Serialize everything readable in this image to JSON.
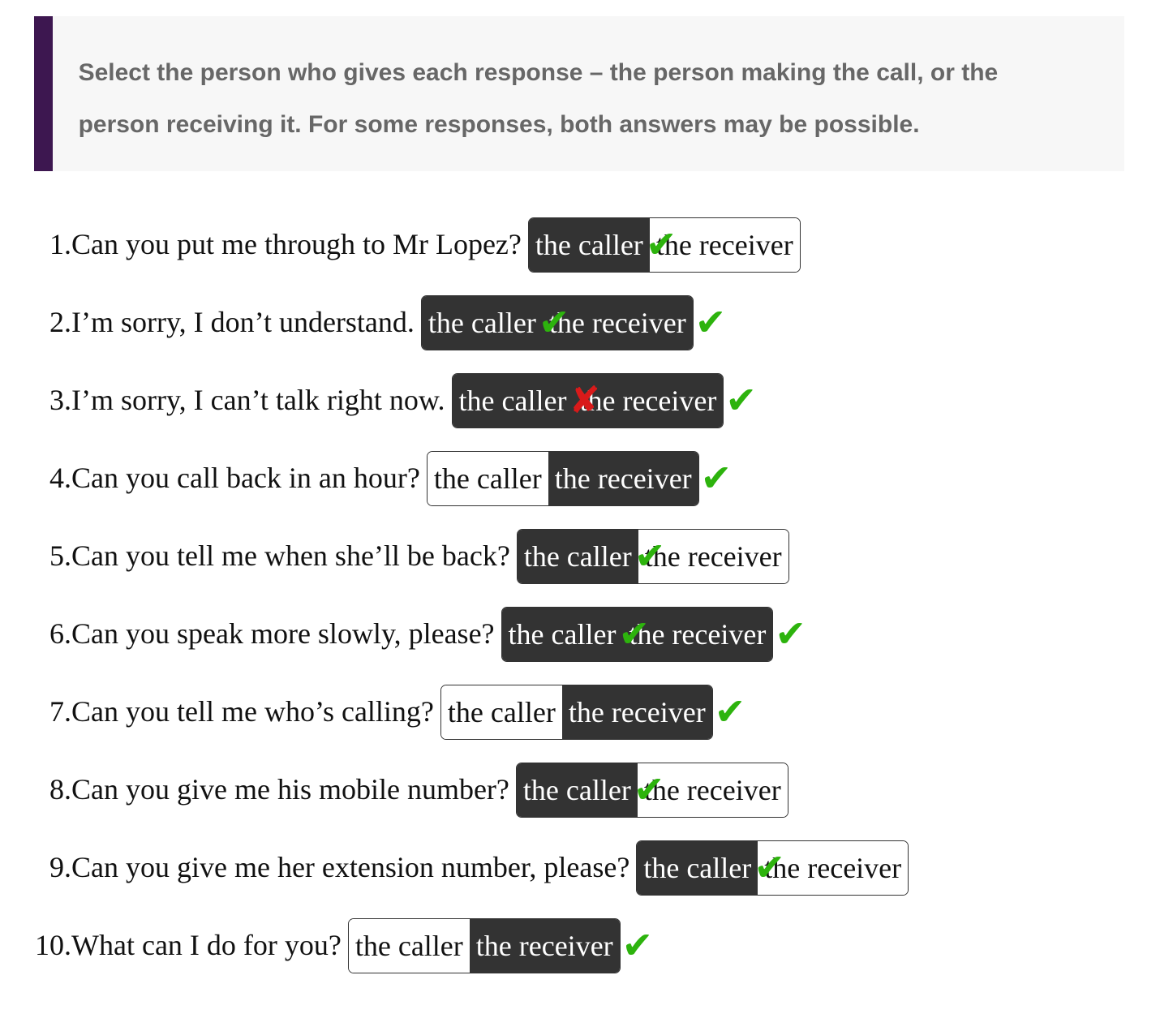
{
  "instructions": "Select the person who gives each response – the person making the call, or the person receiving it. For some responses, both answers may be possible.",
  "colors": {
    "accent_bar": "#3d1750",
    "selected_bg": "#333333",
    "correct": "#2db30d",
    "incorrect": "#d91a1a"
  },
  "option_labels": {
    "caller": "the caller",
    "receiver": "the receiver"
  },
  "icons": {
    "correct": "checkmark-icon",
    "incorrect": "cross-icon"
  },
  "questions": [
    {
      "num": "1.",
      "text": "Can you put me through to Mr Lopez?",
      "caller": true,
      "receiver": false,
      "inline_mark": "correct",
      "trailing_mark": null
    },
    {
      "num": "2.",
      "text": "I’m sorry, I don’t understand.",
      "caller": true,
      "receiver": true,
      "inline_mark": "correct",
      "trailing_mark": "correct"
    },
    {
      "num": "3.",
      "text": "I’m sorry, I can’t talk right now.",
      "caller": true,
      "receiver": true,
      "inline_mark": "incorrect",
      "trailing_mark": "correct"
    },
    {
      "num": "4.",
      "text": "Can you call back in an hour?",
      "caller": false,
      "receiver": true,
      "inline_mark": null,
      "trailing_mark": "correct"
    },
    {
      "num": "5.",
      "text": "Can you tell me when she’ll be back?",
      "caller": true,
      "receiver": false,
      "inline_mark": "correct",
      "trailing_mark": null
    },
    {
      "num": "6.",
      "text": "Can you speak more slowly, please?",
      "caller": true,
      "receiver": true,
      "inline_mark": "correct",
      "trailing_mark": "correct"
    },
    {
      "num": "7.",
      "text": "Can you tell me who’s calling?",
      "caller": false,
      "receiver": true,
      "inline_mark": null,
      "trailing_mark": "correct"
    },
    {
      "num": "8.",
      "text": "Can you give me his mobile number?",
      "caller": true,
      "receiver": false,
      "inline_mark": "correct",
      "trailing_mark": null
    },
    {
      "num": "9.",
      "text": "Can you give me her extension number, please?",
      "caller": true,
      "receiver": false,
      "inline_mark": "correct",
      "trailing_mark": null
    },
    {
      "num": "10.",
      "text": "What can I do for you?",
      "caller": false,
      "receiver": true,
      "inline_mark": null,
      "trailing_mark": "correct"
    }
  ]
}
